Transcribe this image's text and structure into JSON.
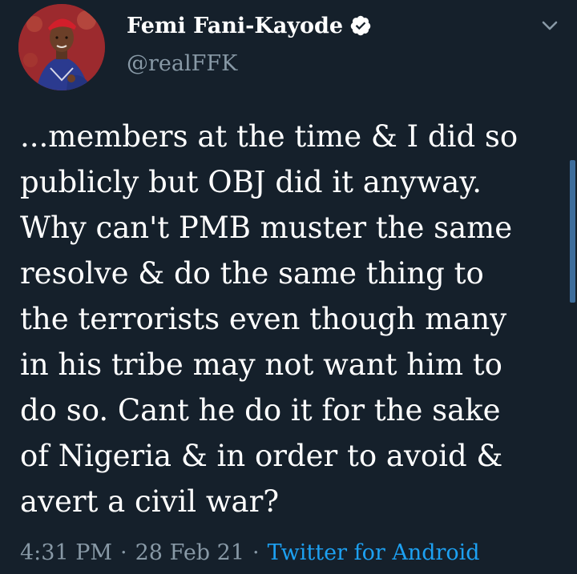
{
  "author": {
    "display_name": "Femi Fani-Kayode",
    "handle": "@realFFK",
    "verified_icon": "verified-badge-icon"
  },
  "tweet": {
    "text": "...members at the time & I did so\npublicly but OBJ did it anyway.\nWhy can't PMB muster the same\nresolve & do the same thing to\nthe terrorists even though many\nin his tribe may not want him to\ndo so. Cant he do it for the sake\nof Nigeria & in order to avoid &\navert a civil war?"
  },
  "meta": {
    "time": "4:31 PM",
    "separator": "·",
    "date": "28 Feb 21",
    "source": "Twitter for Android"
  },
  "colors": {
    "background": "#15202b",
    "text": "#ffffff",
    "secondary": "#8899a6",
    "link": "#1da1f2"
  }
}
